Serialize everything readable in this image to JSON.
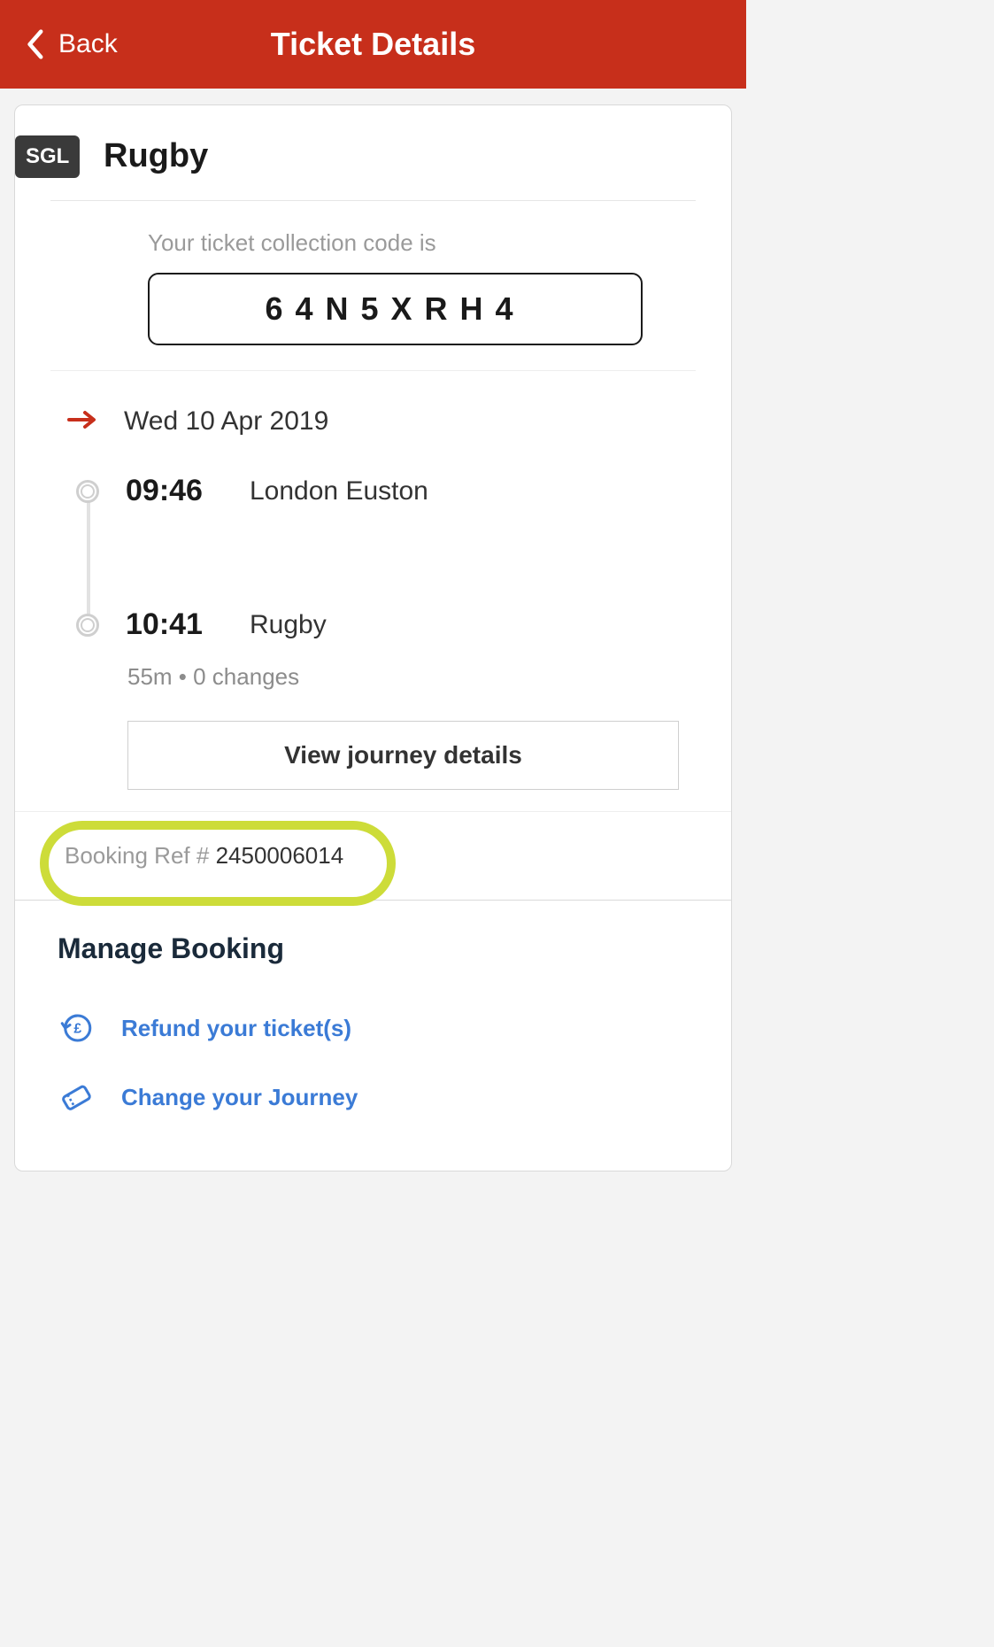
{
  "header": {
    "back_label": "Back",
    "title": "Ticket Details"
  },
  "ticket": {
    "type_badge": "SGL",
    "destination": "Rugby",
    "collection_label": "Your ticket collection code is",
    "collection_code": "64N5XRH4"
  },
  "journey": {
    "date": "Wed 10 Apr 2019",
    "departure": {
      "time": "09:46",
      "station": "London Euston"
    },
    "arrival": {
      "time": "10:41",
      "station": "Rugby"
    },
    "summary": "55m • 0 changes",
    "view_details_label": "View journey details"
  },
  "booking": {
    "ref_label": "Booking Ref # ",
    "ref_value": "2450006014"
  },
  "manage": {
    "title": "Manage Booking",
    "refund_label": "Refund your ticket(s)",
    "change_label": "Change your Journey"
  },
  "colors": {
    "brand_red": "#c72f1b",
    "link_blue": "#3b7bd6",
    "highlight": "#cddc39"
  }
}
